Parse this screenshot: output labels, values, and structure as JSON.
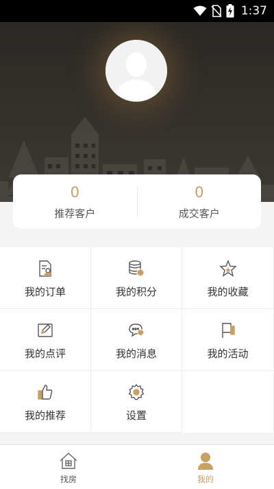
{
  "status_bar": {
    "time": "1:37"
  },
  "stats": [
    {
      "value": "0",
      "label": "推荐客户"
    },
    {
      "value": "0",
      "label": "成交客户"
    }
  ],
  "menu": [
    {
      "label": "我的订单",
      "icon": "order-icon"
    },
    {
      "label": "我的积分",
      "icon": "points-icon"
    },
    {
      "label": "我的收藏",
      "icon": "favorite-star-icon"
    },
    {
      "label": "我的点评",
      "icon": "review-icon"
    },
    {
      "label": "我的消息",
      "icon": "message-icon"
    },
    {
      "label": "我的活动",
      "icon": "activity-flag-icon"
    },
    {
      "label": "我的推荐",
      "icon": "thumbs-up-icon"
    },
    {
      "label": "设置",
      "icon": "settings-gear-icon"
    }
  ],
  "bottom_nav": [
    {
      "label": "找房",
      "icon": "house-icon",
      "active": false
    },
    {
      "label": "我的",
      "icon": "user-icon",
      "active": true
    }
  ],
  "colors": {
    "accent": "#c8a063",
    "hero_bg": "#2f2c28",
    "icon_stroke": "#555555"
  }
}
